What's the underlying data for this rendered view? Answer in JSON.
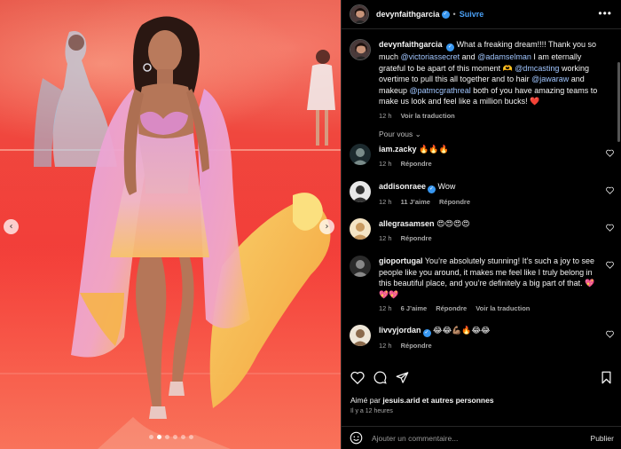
{
  "post": {
    "author": "devynfaithgarcia",
    "follow_label": "Suivre",
    "more_label": "•••",
    "caption": {
      "author": "devynfaithgarcia",
      "parts": [
        {
          "t": "What a freaking dream!!!! Thank you so much ",
          "m": false
        },
        {
          "t": "@victoriassecret",
          "m": true
        },
        {
          "t": " and ",
          "m": false
        },
        {
          "t": "@adamselman",
          "m": true
        },
        {
          "t": " I am eternally grateful to be apart of this moment 🫶 ",
          "m": false
        },
        {
          "t": "@dmcasting",
          "m": true
        },
        {
          "t": " working overtime to pull this all together and to hair ",
          "m": false
        },
        {
          "t": "@jawaraw",
          "m": true
        },
        {
          "t": " and makeup ",
          "m": false
        },
        {
          "t": "@patmcgrathreal",
          "m": true
        },
        {
          "t": " both of you have amazing teams to make us look and feel like a million bucks! ❤️",
          "m": false
        }
      ],
      "time": "12 h",
      "translate": "Voir la traduction"
    },
    "filter_label": "Pour vous",
    "comments": [
      {
        "user": "iam.zacky",
        "verified": false,
        "text": "🔥🔥🔥",
        "time": "12 h",
        "likes": "",
        "reply": "Répondre",
        "translate": ""
      },
      {
        "user": "addisonraee",
        "verified": true,
        "text": "Wow",
        "time": "12 h",
        "likes": "11 J’aime",
        "reply": "Répondre",
        "translate": ""
      },
      {
        "user": "allegrasamsen",
        "verified": false,
        "text": "😍😍😍😍",
        "time": "12 h",
        "likes": "",
        "reply": "Répondre",
        "translate": ""
      },
      {
        "user": "gioportugal",
        "verified": false,
        "text": "You’re absolutely stunning! It’s such a joy to see people like you around, it makes me feel like I truly belong in this beautiful place, and you’re definitely a big part of that. 💖💖💖",
        "time": "12 h",
        "likes": "6 J’aime",
        "reply": "Répondre",
        "translate": "Voir la traduction"
      },
      {
        "user": "livvyjordan",
        "verified": true,
        "text": "😂😂💪🏽🔥😂😂",
        "time": "12 h",
        "likes": "",
        "reply": "Répondre",
        "translate": ""
      }
    ],
    "liked_by_prefix": "Aimé par ",
    "liked_by_user": "jesuis.arid",
    "liked_by_suffix": " et autres personnes",
    "time_ago": "Il y a 12 heures",
    "comment_placeholder": "Ajouter un commentaire...",
    "publish_label": "Publier"
  },
  "media": {
    "prev_label": "‹",
    "next_label": "›",
    "slide_index": 2,
    "slide_count": 6
  },
  "colors": {
    "accent": "#4aa0f5",
    "mention": "#a1c6ff",
    "verified": "#3897f0",
    "heart": "#ed4956"
  }
}
